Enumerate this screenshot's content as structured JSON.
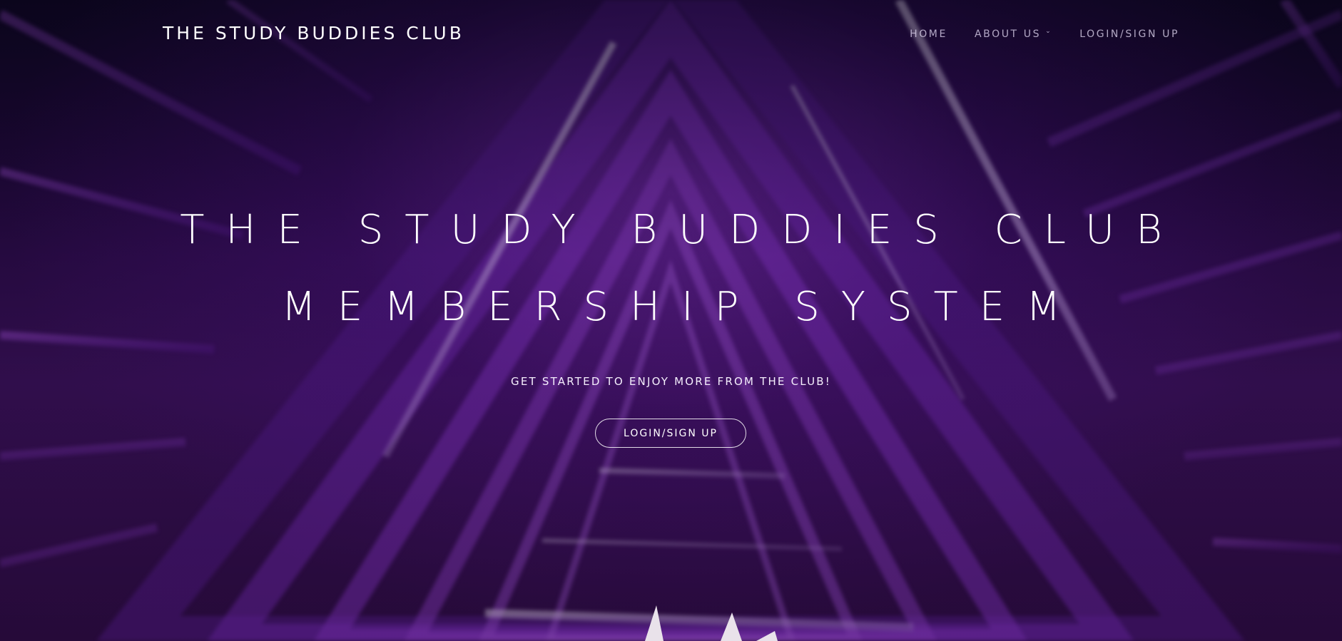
{
  "header": {
    "brand": "THE STUDY BUDDIES CLUB",
    "nav": {
      "home": "HOME",
      "about": "ABOUT US",
      "login": "LOGIN/SIGN UP"
    }
  },
  "hero": {
    "headline_line1": "THE STUDY BUDDIES CLUB",
    "headline_line2": "MEMBERSHIP SYSTEM",
    "tagline": "GET STARTED TO ENJOY MORE FROM THE CLUB!",
    "cta_label": "LOGIN/SIGN UP"
  },
  "icons": {
    "about_dropdown": "chevron-down-icon"
  },
  "colors": {
    "text": "#ffffff",
    "nav_text": "#e6dcf5",
    "background_dark": "#1b0a2e",
    "accent_purple": "#a03ce6"
  }
}
